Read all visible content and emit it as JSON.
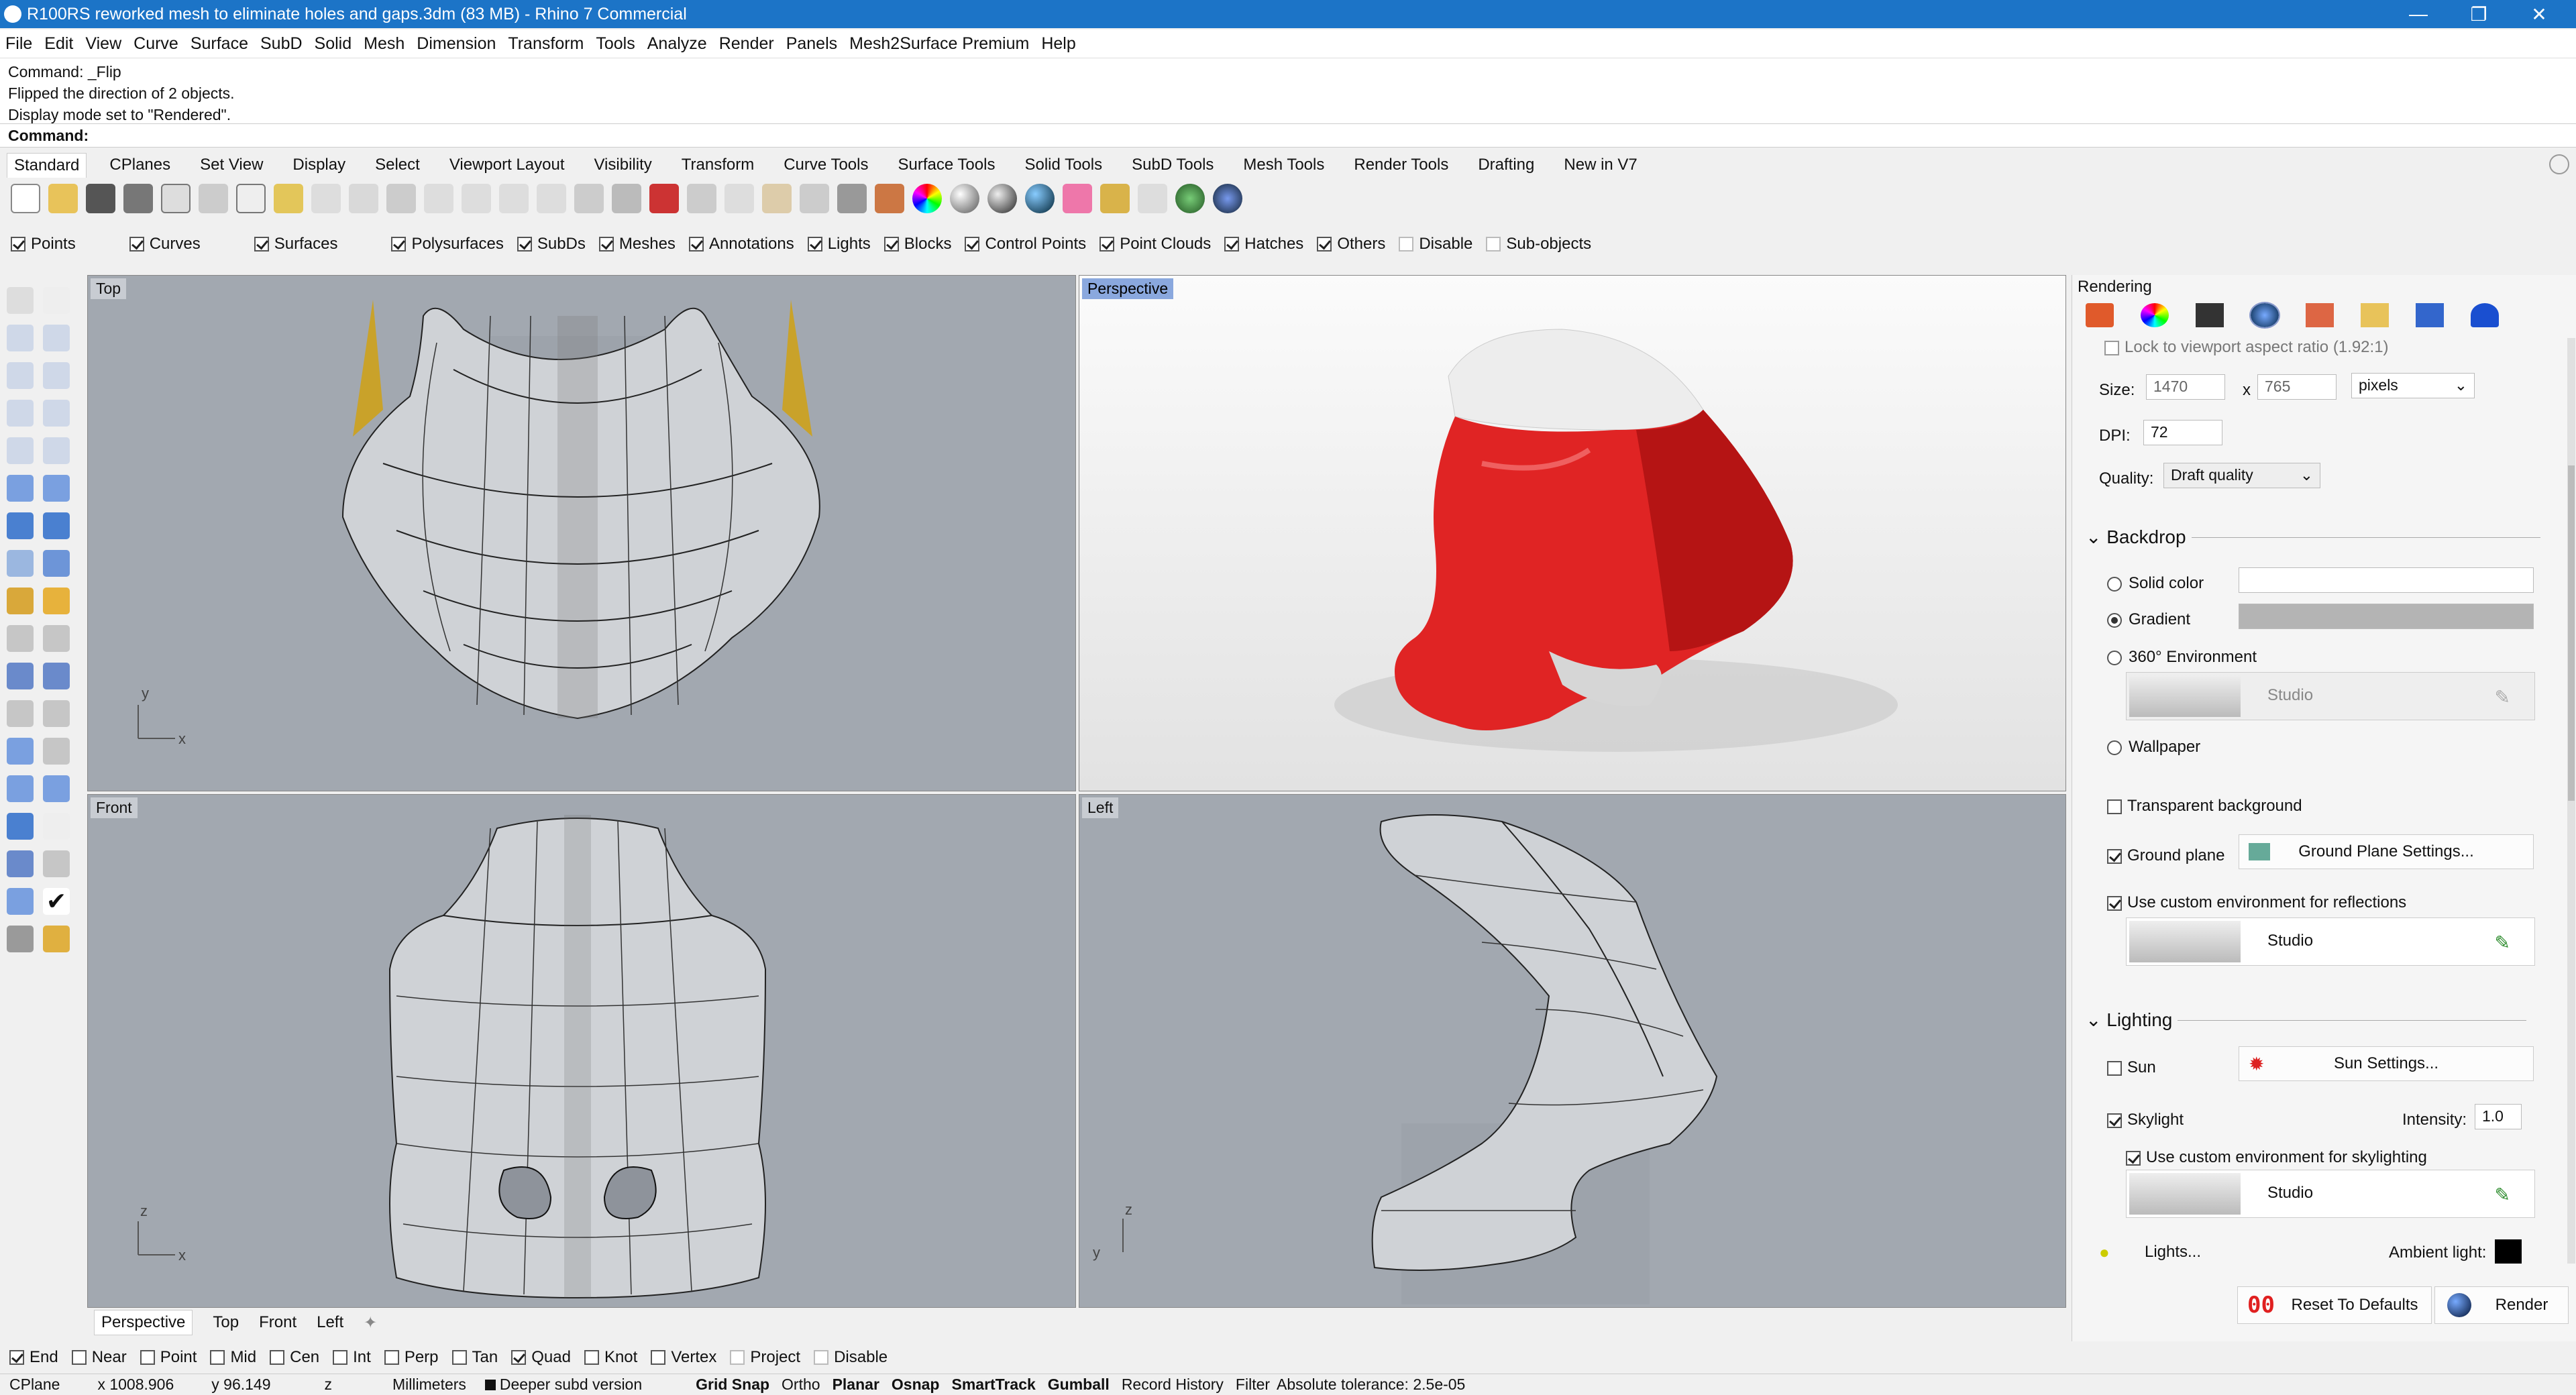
{
  "window": {
    "title": "R100RS reworked mesh to eliminate holes and gaps.3dm (83 MB) - Rhino 7 Commercial"
  },
  "menu": [
    "File",
    "Edit",
    "View",
    "Curve",
    "Surface",
    "SubD",
    "Solid",
    "Mesh",
    "Dimension",
    "Transform",
    "Tools",
    "Analyze",
    "Render",
    "Panels",
    "Mesh2Surface Premium",
    "Help"
  ],
  "command_history": [
    "Command: _Flip",
    "Flipped the direction of 2 objects.",
    "Display mode set to \"Rendered\"."
  ],
  "command_prompt": "Command:",
  "toolbar_tabs": [
    "Standard",
    "CPlanes",
    "Set View",
    "Display",
    "Select",
    "Viewport Layout",
    "Visibility",
    "Transform",
    "Curve Tools",
    "Surface Tools",
    "Solid Tools",
    "SubD Tools",
    "Mesh Tools",
    "Render Tools",
    "Drafting",
    "New in V7"
  ],
  "filters": [
    {
      "label": "Points",
      "checked": true
    },
    {
      "label": "Curves",
      "checked": true
    },
    {
      "label": "Surfaces",
      "checked": true
    },
    {
      "label": "Polysurfaces",
      "checked": true
    },
    {
      "label": "SubDs",
      "checked": true
    },
    {
      "label": "Meshes",
      "checked": true
    },
    {
      "label": "Annotations",
      "checked": true
    },
    {
      "label": "Lights",
      "checked": true
    },
    {
      "label": "Blocks",
      "checked": true
    },
    {
      "label": "Control Points",
      "checked": true
    },
    {
      "label": "Point Clouds",
      "checked": true
    },
    {
      "label": "Hatches",
      "checked": true
    },
    {
      "label": "Others",
      "checked": true
    },
    {
      "label": "Disable",
      "checked": false
    },
    {
      "label": "Sub-objects",
      "checked": false
    }
  ],
  "viewports": {
    "top": "Top",
    "perspective": "Perspective",
    "front": "Front",
    "left": "Left"
  },
  "viewport_tabs": [
    "Perspective",
    "Top",
    "Front",
    "Left"
  ],
  "osnaps": [
    {
      "label": "End",
      "checked": true
    },
    {
      "label": "Near",
      "checked": false
    },
    {
      "label": "Point",
      "checked": false
    },
    {
      "label": "Mid",
      "checked": false
    },
    {
      "label": "Cen",
      "checked": false
    },
    {
      "label": "Int",
      "checked": false
    },
    {
      "label": "Perp",
      "checked": false
    },
    {
      "label": "Tan",
      "checked": false
    },
    {
      "label": "Quad",
      "checked": true
    },
    {
      "label": "Knot",
      "checked": false
    },
    {
      "label": "Vertex",
      "checked": false
    },
    {
      "label": "Project",
      "checked": false
    },
    {
      "label": "Disable",
      "checked": false
    }
  ],
  "status": {
    "cplane": "CPlane",
    "x": "x 1008.906",
    "y": "y 96.149",
    "z": "z",
    "units": "Millimeters",
    "layer": "Deeper subd version",
    "toggles": [
      "Grid Snap",
      "Ortho",
      "Planar",
      "Osnap",
      "SmartTrack",
      "Gumball",
      "Record History",
      "Filter"
    ],
    "tolerance": "Absolute tolerance: 2.5e-05"
  },
  "rendering_panel": {
    "title": "Rendering",
    "lock_aspect": "Lock to viewport aspect ratio (1.92:1)",
    "size_label": "Size:",
    "width": "1470",
    "height": "765",
    "size_sep": "x",
    "units": "pixels",
    "dpi_label": "DPI:",
    "dpi": "72",
    "quality_label": "Quality:",
    "quality": "Draft quality",
    "backdrop": "Backdrop",
    "solid_color": "Solid color",
    "gradient": "Gradient",
    "env360": "360° Environment",
    "studio": "Studio",
    "wallpaper": "Wallpaper",
    "transparent_bg": "Transparent background",
    "ground_plane": "Ground plane",
    "ground_plane_btn": "Ground Plane Settings...",
    "custom_env_refl": "Use custom environment for reflections",
    "lighting": "Lighting",
    "sun": "Sun",
    "sun_btn": "Sun Settings...",
    "skylight": "Skylight",
    "intensity_label": "Intensity:",
    "intensity": "1.0",
    "custom_env_sky": "Use custom environment for skylighting",
    "lights_btn": "Lights...",
    "ambient_label": "Ambient light:",
    "reset_btn": "Reset To Defaults",
    "render_btn": "Render"
  }
}
